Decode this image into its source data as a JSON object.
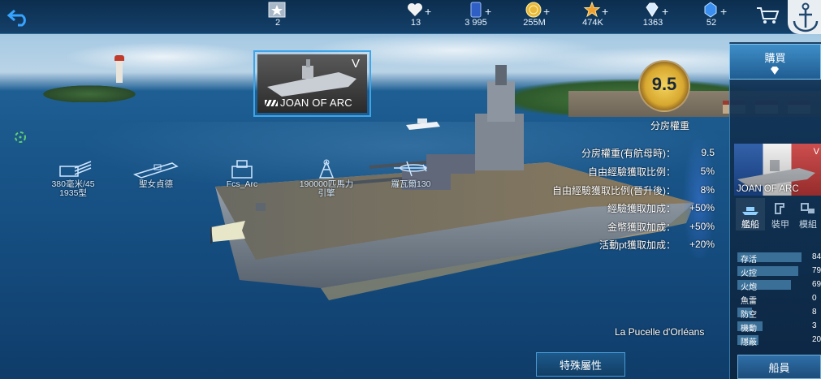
{
  "top_bar": {
    "rank": {
      "icon": "rank-star-icon",
      "value": "2"
    },
    "resources": [
      {
        "name": "stamina",
        "icon": "heart-icon",
        "value": "13",
        "color": "#f2f2f2"
      },
      {
        "name": "blueprint",
        "icon": "blueprint-card-icon",
        "value": "3 995",
        "color": "#3b6fd8"
      },
      {
        "name": "gold",
        "icon": "gold-coin-icon",
        "value": "255M",
        "color": "#e8b83a"
      },
      {
        "name": "exp",
        "icon": "gold-star-icon",
        "value": "474K",
        "color": "#f0a030"
      },
      {
        "name": "diamond",
        "icon": "diamond-icon",
        "value": "1363",
        "color": "#d8ecff"
      },
      {
        "name": "crystal",
        "icon": "blue-crystal-icon",
        "value": "52",
        "color": "#3a8ef0"
      }
    ],
    "plus_glyph": "+"
  },
  "ship_card": {
    "tier": "V",
    "name": "JOAN OF ARC"
  },
  "weapons": [
    {
      "icon": "main-gun-icon",
      "label": "380毫米/45\n1935型"
    },
    {
      "icon": "secondary-ship-icon",
      "label": "聖女貞德"
    },
    {
      "icon": "fire-control-icon",
      "label": "Fcs_Arc"
    },
    {
      "icon": "engine-icon",
      "label": "190000匹馬力\n引擎"
    },
    {
      "icon": "aircraft-icon",
      "label": "羅瓦爾130"
    }
  ],
  "rating": {
    "value": "9.5",
    "label": "分房權重"
  },
  "bonuses": [
    {
      "label": "分房權重(有航母時)：",
      "value": "9.5"
    },
    {
      "label": "自由經驗獲取比例：",
      "value": "5%"
    },
    {
      "label": "自由經驗獲取比例(晉升後)：",
      "value": "8%"
    },
    {
      "label": "經驗獲取加成：",
      "value": "+50%"
    },
    {
      "label": "金幣獲取加成：",
      "value": "+50%"
    },
    {
      "label": "活動pt獲取加成：",
      "value": "+20%"
    }
  ],
  "motto": "La Pucelle d'Orléans",
  "special_button": "特殊屬性",
  "right_panel": {
    "buy_label": "購買",
    "portrait_name": "JOAN OF ARC",
    "portrait_tier": "V",
    "tabs": [
      {
        "icon": "ship-tab-icon",
        "label": "艦船"
      },
      {
        "icon": "armor-tab-icon",
        "label": "裝甲"
      },
      {
        "icon": "module-tab-icon",
        "label": "模組"
      }
    ],
    "stats": [
      {
        "label": "存活",
        "value": "84",
        "fill": 0.9
      },
      {
        "label": "火控",
        "value": "79",
        "fill": 0.85
      },
      {
        "label": "火炮",
        "value": "69",
        "fill": 0.75
      },
      {
        "label": "魚雷",
        "value": "0",
        "fill": 0.0
      },
      {
        "label": "防空",
        "value": "8",
        "fill": 0.2
      },
      {
        "label": "機動",
        "value": "3",
        "fill": 0.35
      },
      {
        "label": "隱蔽",
        "value": "20",
        "fill": 0.3
      }
    ],
    "crew_label": "船員"
  }
}
